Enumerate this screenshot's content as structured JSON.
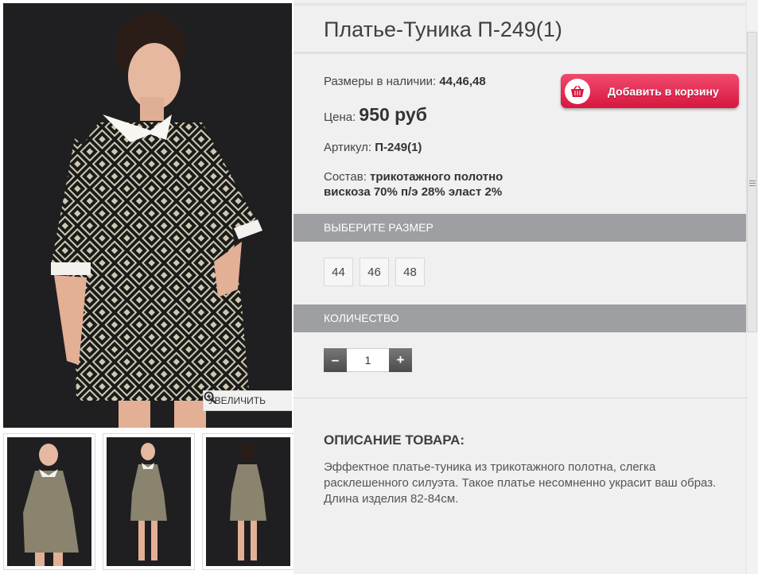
{
  "product": {
    "title": "Платье-Туника П-249(1)",
    "sizes_label": "Размеры в наличии:",
    "sizes_value": "44,46,48",
    "price_label": "Цена:",
    "price_value": "950 руб",
    "article_label": "Артикул:",
    "article_value": "П-249(1)",
    "composition_label": "Состав:",
    "composition_value_1": "трикотажного полотно",
    "composition_value_2": "вискоза 70% п/э 28% эласт 2%"
  },
  "actions": {
    "add_to_cart": "Добавить в корзину",
    "zoom": "УВЕЛИЧИТЬ",
    "cart_icon": "basket-icon",
    "zoom_icon": "magnifier-plus-icon"
  },
  "size_section": {
    "header": "ВЫБЕРИТЕ РАЗМЕР",
    "options": [
      "44",
      "46",
      "48"
    ]
  },
  "quantity_section": {
    "header": "КОЛИЧЕСТВО",
    "minus": "–",
    "value": "1",
    "plus": "+"
  },
  "description": {
    "header": "ОПИСАНИЕ ТОВАРА:",
    "text": "Эффектное платье-туника из трикотажного полотна, слегка расклешенного силуэта.  Такое платье несомненно украсит ваш образ. Длина изделия 82-84см."
  },
  "colors": {
    "accent_red": "#d8163f",
    "bar_gray": "#9d9fa2",
    "panel_bg": "#f0f0f0"
  }
}
